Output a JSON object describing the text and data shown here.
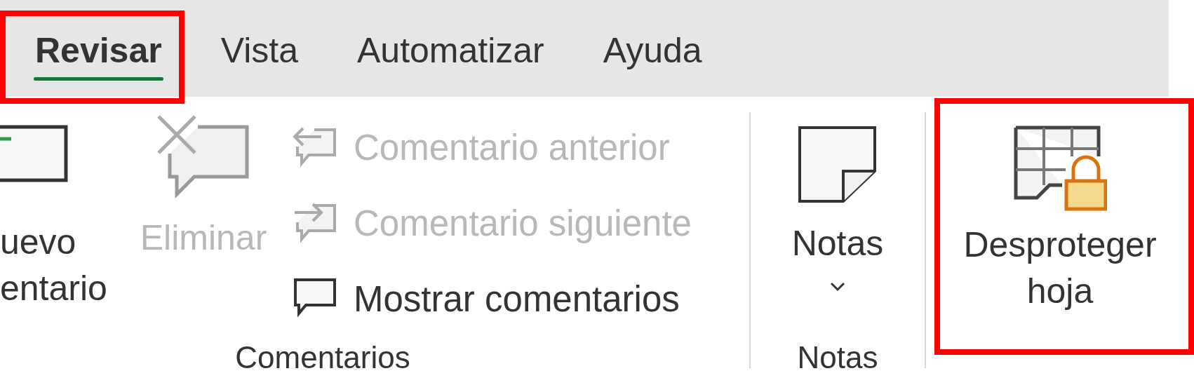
{
  "tabs": [
    {
      "label": "Revisar",
      "selected": true,
      "highlighted": true
    },
    {
      "label": "Vista",
      "selected": false,
      "highlighted": false
    },
    {
      "label": "Automatizar",
      "selected": false,
      "highlighted": false
    },
    {
      "label": "Ayuda",
      "selected": false,
      "highlighted": false
    }
  ],
  "groups": [
    {
      "label": "Comentarios",
      "buttons": [
        {
          "kind": "large",
          "lines": [
            "uevo",
            "entario"
          ],
          "disabled": false,
          "highlighted": false
        },
        {
          "kind": "large",
          "lines": [
            "Eliminar"
          ],
          "disabled": true,
          "highlighted": false
        },
        {
          "kind": "stack",
          "items": [
            {
              "label": "Comentario anterior",
              "disabled": true
            },
            {
              "label": "Comentario siguiente",
              "disabled": true
            },
            {
              "label": "Mostrar comentarios",
              "disabled": false
            }
          ]
        }
      ]
    },
    {
      "label": "Notas",
      "buttons": [
        {
          "kind": "dropdown",
          "lines": [
            "Notas"
          ],
          "disabled": false,
          "highlighted": false
        }
      ]
    },
    {
      "buttons": [
        {
          "kind": "large",
          "lines": [
            "Desproteger",
            "hoja"
          ],
          "disabled": false,
          "highlighted": true
        }
      ]
    }
  ]
}
